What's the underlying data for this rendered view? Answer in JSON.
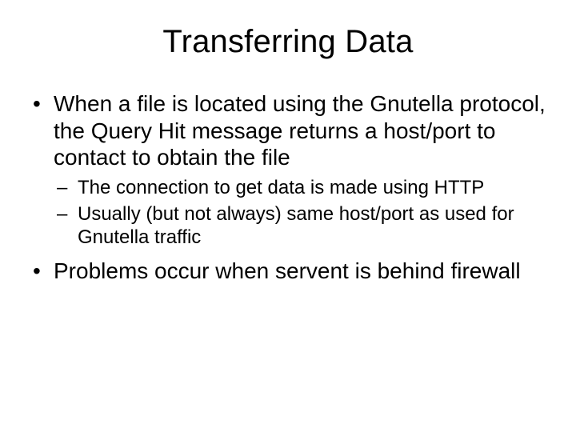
{
  "title": "Transferring Data",
  "bullets": [
    {
      "text": "When a file is located using the Gnutella protocol, the Query Hit message returns a host/port to contact to obtain the file",
      "sub": [
        "The connection to get data is made using HTTP",
        "Usually (but not always) same host/port as used for Gnutella traffic"
      ]
    },
    {
      "text": "Problems occur when servent is behind firewall",
      "sub": []
    }
  ]
}
